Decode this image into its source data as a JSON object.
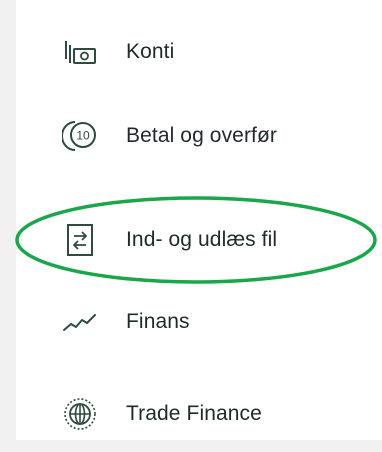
{
  "nav": {
    "items": [
      {
        "label": "Konti",
        "icon": "accounts-cash-icon"
      },
      {
        "label": "Betal og overfør",
        "icon": "coin-10-icon"
      },
      {
        "label": "Ind- og udlæs fil",
        "icon": "file-transfer-icon"
      },
      {
        "label": "Finans",
        "icon": "trend-line-icon"
      },
      {
        "label": "Trade Finance",
        "icon": "globe-icon"
      }
    ]
  },
  "colors": {
    "text": "#1f2a2a",
    "icon": "#2f4a3f",
    "highlight": "#1aa64a",
    "sidebar_bg": "#f0f1f0"
  }
}
